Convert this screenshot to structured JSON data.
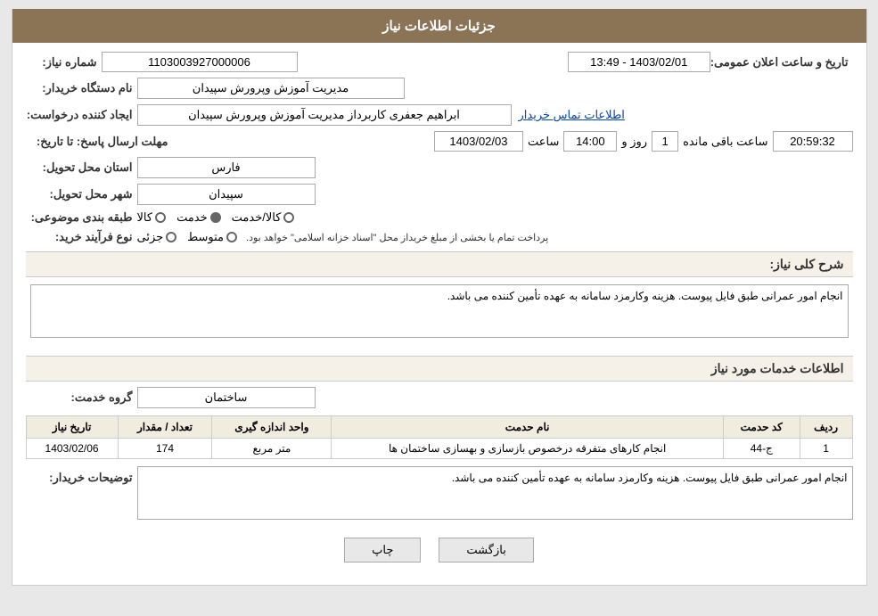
{
  "header": {
    "title": "جزئیات اطلاعات نیاز"
  },
  "need_number_label": "شماره نیاز:",
  "need_number_value": "1103003927000006",
  "requester_org_label": "نام دستگاه خریدار:",
  "requester_org_value": "مدیریت آموزش وپرورش سپیدان",
  "requester_label": "ایجاد کننده درخواست:",
  "requester_value": "ابراهیم جعفری کاربرداز مدیریت آموزش وپرورش سپیدان",
  "contact_link": "اطلاعات تماس خریدار",
  "deadline_label": "مهلت ارسال پاسخ: تا تاریخ:",
  "deadline_date": "1403/02/03",
  "deadline_time_label": "ساعت",
  "deadline_time": "14:00",
  "deadline_days_label": "روز و",
  "deadline_days": "1",
  "deadline_remaining": "20:59:32",
  "deadline_remaining_label": "ساعت باقی مانده",
  "announce_label": "تاریخ و ساعت اعلان عمومی:",
  "announce_value": "1403/02/01 - 13:49",
  "province_label": "استان محل تحویل:",
  "province_value": "فارس",
  "city_label": "شهر محل تحویل:",
  "city_value": "سپیدان",
  "category_label": "طبقه بندی موضوعی:",
  "category_options": [
    "کالا",
    "خدمت",
    "کالا/خدمت"
  ],
  "category_selected": "خدمت",
  "process_label": "نوع فرآیند خرید:",
  "process_options": [
    "جزئی",
    "متوسط"
  ],
  "process_note": "پرداخت تمام یا بخشی از مبلغ خریداز محل \"اسناد خزانه اسلامی\" خواهد بود.",
  "general_desc_label": "شرح کلی نیاز:",
  "general_desc_value": "انجام امور عمرانی طبق فایل پیوست. هزینه وکارمزد سامانه به عهده تأمین کننده می باشد.",
  "service_section_title": "اطلاعات خدمات مورد نیاز",
  "service_group_label": "گروه خدمت:",
  "service_group_value": "ساختمان",
  "table": {
    "columns": [
      "ردیف",
      "کد حدمت",
      "نام حدمت",
      "واحد اندازه گیری",
      "تعداد / مقدار",
      "تاریخ نیاز"
    ],
    "rows": [
      {
        "row": "1",
        "code": "ج-44",
        "name": "انجام کارهای متفرقه درخصوص بازسازی و بهسازی ساختمان ها",
        "unit": "متر مربع",
        "quantity": "174",
        "date": "1403/02/06"
      }
    ]
  },
  "buyer_notes_label": "توضیحات خریدار:",
  "buyer_notes_value": "انجام امور عمرانی طبق فایل پیوست. هزینه وکارمزد سامانه به عهده تأمین کننده می باشد.",
  "buttons": {
    "print": "چاپ",
    "back": "بازگشت"
  }
}
